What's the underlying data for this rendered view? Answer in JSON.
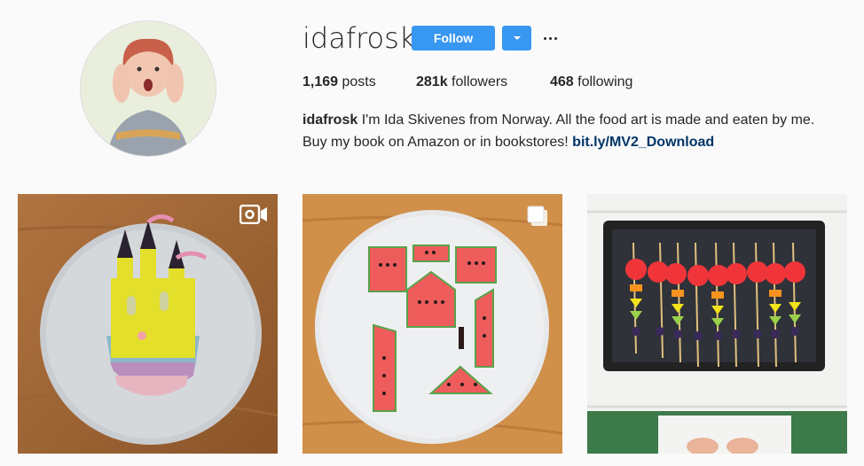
{
  "profile": {
    "username": "idafrosk",
    "follow_label": "Follow",
    "stats": {
      "posts_count": "1,169",
      "posts_label": "posts",
      "followers_count": "281k",
      "followers_label": "followers",
      "following_count": "468",
      "following_label": "following"
    },
    "bio": {
      "name": "idafrosk",
      "line1": "I'm Ida Skivenes from Norway. All the food art is made and eaten by me.",
      "line2": "Buy my book on Amazon or in bookstores!",
      "link": "bit.ly/MV2_Download"
    }
  },
  "posts": [
    {
      "badge_icon": "video-camera-icon"
    },
    {
      "badge_icon": "multiple-photos-icon"
    },
    {
      "badge_icon": ""
    }
  ],
  "colors": {
    "accent": "#3897f0",
    "link": "#003569",
    "text": "#262626",
    "background": "#fafafa"
  }
}
